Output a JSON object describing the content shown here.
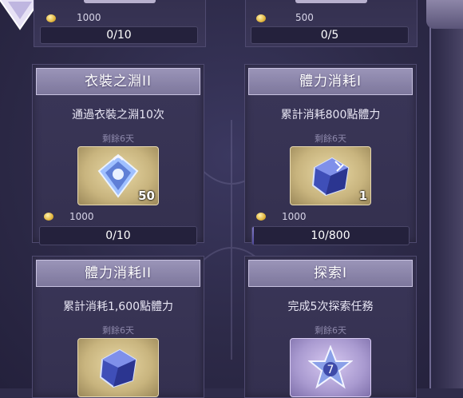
{
  "top_cards": [
    {
      "cost": "1000",
      "progress": "0/10",
      "fill": 0
    },
    {
      "cost": "500",
      "progress": "0/5",
      "fill": 0
    }
  ],
  "cards": [
    {
      "title": "衣裝之淵II",
      "description": "通過衣裝之淵10次",
      "remaining": "剩餘6天",
      "reward_icon": "shield-gem-icon",
      "reward_count": "50",
      "cost": "1000",
      "progress": "0/10",
      "fill": 0
    },
    {
      "title": "體力消耗I",
      "description": "累計消耗800點體力",
      "remaining": "剩餘6天",
      "reward_icon": "blue-crystal-cube-icon",
      "reward_count": "1",
      "cost": "1000",
      "progress": "10/800",
      "fill": 0.0125
    },
    {
      "title": "體力消耗II",
      "description": "累計消耗1,600點體力",
      "remaining": "剩餘6天",
      "reward_icon": "blue-crystal-cube-icon"
    },
    {
      "title": "探索I",
      "description": "完成5次探索任務",
      "remaining": "剩餘6天",
      "reward_icon": "star-badge-icon"
    }
  ],
  "colors": {
    "background": "#2f2c4a",
    "card_header": "#8a84aa",
    "coin": "#e2b63e",
    "progress_fill": "#6f68b8"
  }
}
